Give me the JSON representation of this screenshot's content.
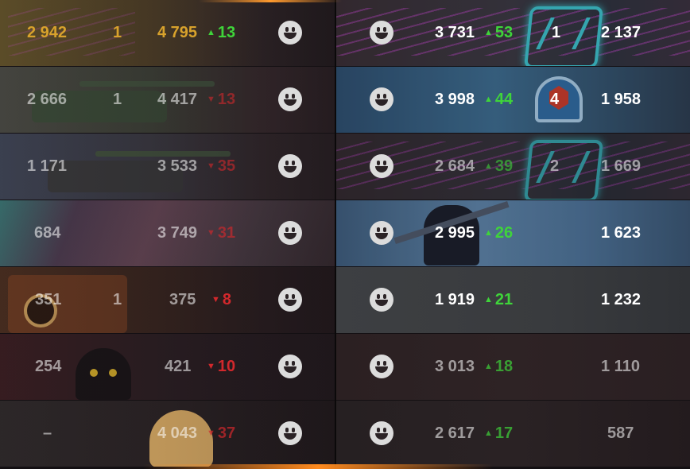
{
  "icons": {
    "smiley": "smiley-icon",
    "up_arrow": "▲",
    "down_arrow": "▼"
  },
  "colors": {
    "up": "#3fd43a",
    "down": "#d2282c",
    "gold": "#d8a22c"
  },
  "left_rows": [
    {
      "a": "2 942",
      "b": "1",
      "c": "4 795",
      "delta": "13",
      "dir": "up"
    },
    {
      "a": "2 666",
      "b": "1",
      "c": "4 417",
      "delta": "13",
      "dir": "down"
    },
    {
      "a": "1 171",
      "b": "",
      "c": "3 533",
      "delta": "35",
      "dir": "down"
    },
    {
      "a": "684",
      "b": "",
      "c": "3 749",
      "delta": "31",
      "dir": "down"
    },
    {
      "a": "351",
      "b": "1",
      "c": "375",
      "delta": "8",
      "dir": "down"
    },
    {
      "a": "254",
      "b": "",
      "c": "421",
      "delta": "10",
      "dir": "down"
    },
    {
      "a": "–",
      "b": "",
      "c": "4 043",
      "delta": "37",
      "dir": "down"
    }
  ],
  "right_rows": [
    {
      "a": "3 731",
      "delta": "53",
      "dir": "up",
      "b": "1",
      "c": "2 137"
    },
    {
      "a": "3 998",
      "delta": "44",
      "dir": "up",
      "b": "4",
      "c": "1 958"
    },
    {
      "a": "2 684",
      "delta": "39",
      "dir": "up",
      "b": "2",
      "c": "1 669"
    },
    {
      "a": "2 995",
      "delta": "26",
      "dir": "up",
      "b": "",
      "c": "1 623"
    },
    {
      "a": "1 919",
      "delta": "21",
      "dir": "up",
      "b": "",
      "c": "1 232"
    },
    {
      "a": "3 013",
      "delta": "18",
      "dir": "up",
      "b": "",
      "c": "1 110"
    },
    {
      "a": "2 617",
      "delta": "17",
      "dir": "up",
      "b": "",
      "c": "587"
    }
  ]
}
